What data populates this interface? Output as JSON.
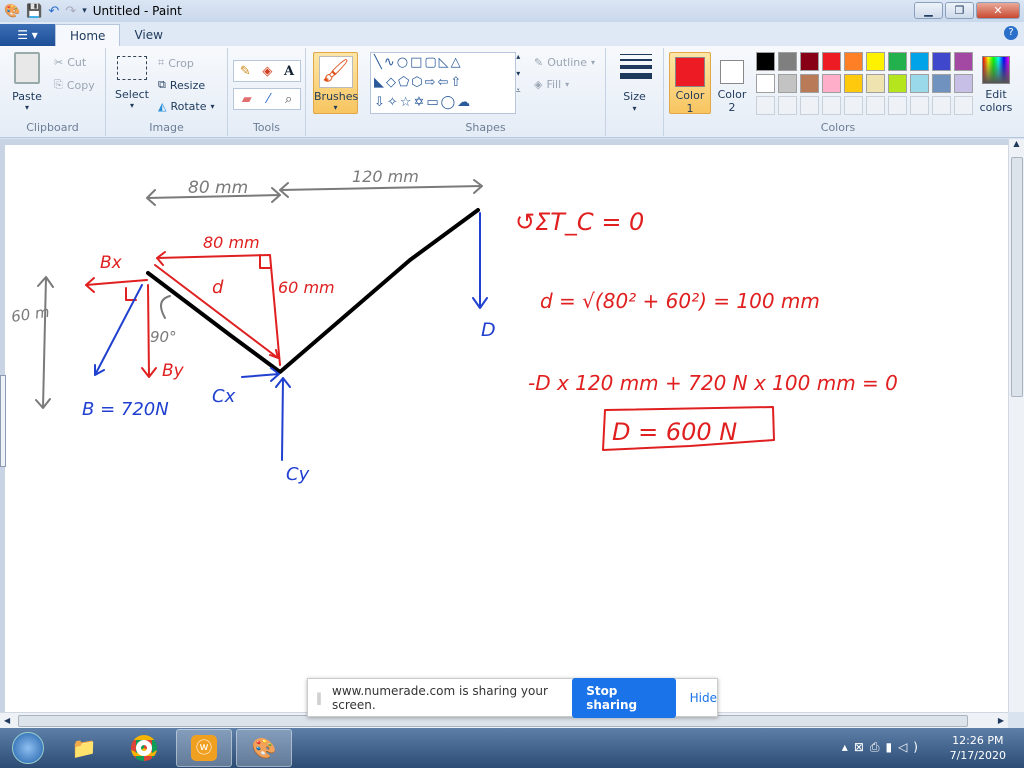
{
  "window": {
    "title": "Untitled - Paint"
  },
  "tabs": [
    {
      "label": "Home"
    },
    {
      "label": "View"
    }
  ],
  "ribbon": {
    "clipboard": {
      "label": "Clipboard",
      "paste": "Paste",
      "cut": "Cut",
      "copy": "Copy"
    },
    "image": {
      "label": "Image",
      "select": "Select",
      "crop": "Crop",
      "resize": "Resize",
      "rotate": "Rotate"
    },
    "tools": {
      "label": "Tools"
    },
    "brushes": {
      "label": "Brushes"
    },
    "shapes": {
      "label": "Shapes",
      "outline": "Outline",
      "fill": "Fill"
    },
    "size": {
      "label": "Size"
    },
    "colors": {
      "label": "Colors",
      "color1": "Color 1",
      "color2": "Color 2",
      "edit": "Edit colors",
      "color1_value": "#ed1c24",
      "color2_value": "#ffffff",
      "palette_row1": [
        "#000000",
        "#7f7f7f",
        "#880015",
        "#ed1c24",
        "#ff7f27",
        "#fff200",
        "#22b14c",
        "#00a2e8",
        "#3f48cc",
        "#a349a4"
      ],
      "palette_row2": [
        "#ffffff",
        "#c3c3c3",
        "#b97a57",
        "#ffaec9",
        "#ffc90e",
        "#efe4b0",
        "#b5e61d",
        "#99d9ea",
        "#7092be",
        "#c8bfe7"
      ]
    }
  },
  "drawing": {
    "dim_top_left": "80 mm",
    "dim_top_right": "120 mm",
    "dim_left": "60 m",
    "bx": "Bx",
    "by": "By",
    "b_force": "B = 720N",
    "cx": "Cx",
    "cy": "Cy",
    "d_label": "D",
    "inner_80": "80 mm",
    "inner_d": "d",
    "inner_60": "60 mm",
    "angle": "90°",
    "eq1": "↺ΣT_C = 0",
    "eq2": "d = √(80² + 60²) = 100 mm",
    "eq3": "-D x 120 mm + 720 N x 100 mm = 0",
    "eq4": "D = 600 N"
  },
  "share_bar": {
    "message": "www.numerade.com is sharing your screen.",
    "stop": "Stop sharing",
    "hide": "Hide"
  },
  "taskbar": {
    "time": "12:26 PM",
    "date": "7/17/2020"
  }
}
